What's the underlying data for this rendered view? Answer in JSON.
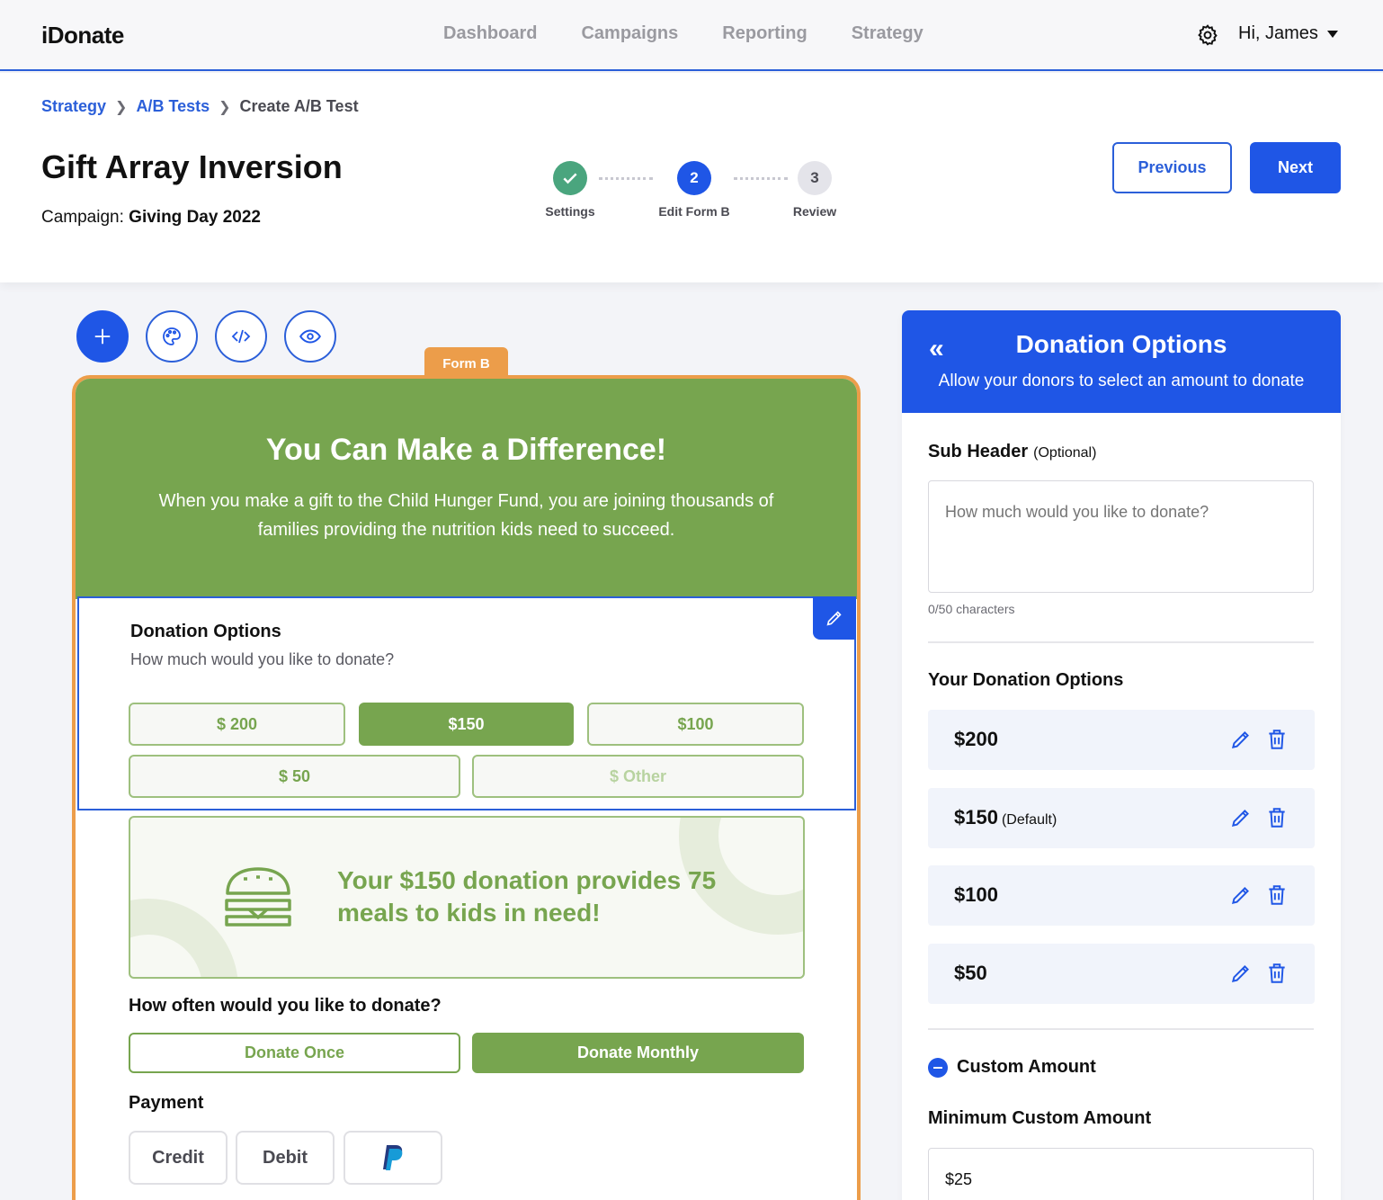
{
  "app": {
    "logo": "iDonate"
  },
  "nav": {
    "items": [
      "Dashboard",
      "Campaigns",
      "Reporting",
      "Strategy"
    ],
    "user_greeting": "Hi, James"
  },
  "breadcrumb": {
    "items": [
      "Strategy",
      "A/B Tests"
    ],
    "current": "Create A/B Test"
  },
  "page": {
    "title": "Gift Array Inversion",
    "campaign_label": "Campaign:",
    "campaign_name": "Giving Day 2022"
  },
  "stepper": {
    "steps": [
      {
        "number": "",
        "label": "Settings",
        "state": "complete"
      },
      {
        "number": "2",
        "label": "Edit Form B",
        "state": "active"
      },
      {
        "number": "3",
        "label": "Review",
        "state": "pending"
      }
    ]
  },
  "actions": {
    "previous": "Previous",
    "next": "Next"
  },
  "toolbar": {
    "icons": [
      "plus-icon",
      "palette-icon",
      "code-icon",
      "eye-icon"
    ]
  },
  "form": {
    "tab_label": "Form B",
    "hero_title": "You Can Make a Difference!",
    "hero_text": "When you make a gift to the Child Hunger Fund, you are joining thousands of families providing the nutrition kids need to succeed.",
    "donation_options_title": "Donation Options",
    "donation_options_sub": "How much would you like to donate?",
    "amounts": [
      "$ 200",
      "$150",
      "$100",
      "$ 50",
      "$ Other"
    ],
    "selected_amount": "$150",
    "impact_message": "Your $150 donation provides 75 meals to kids in need!",
    "frequency_title": "How often would you like to donate?",
    "frequency": {
      "once": "Donate Once",
      "monthly": "Donate Monthly",
      "selected": "Donate Monthly"
    },
    "payment_title": "Payment",
    "payment": [
      "Credit",
      "Debit"
    ]
  },
  "panel": {
    "title": "Donation Options",
    "subtitle": "Allow your donors to select an amount to donate",
    "sub_header_label": "Sub Header",
    "sub_header_optional": "(Optional)",
    "sub_header_value": "How much would you like to donate?",
    "char_count": "0/50 characters",
    "your_options_title": "Your Donation Options",
    "options": [
      {
        "value": "$200",
        "note": ""
      },
      {
        "value": "$150",
        "note": "(Default)"
      },
      {
        "value": "$100",
        "note": ""
      },
      {
        "value": "$50",
        "note": ""
      }
    ],
    "custom_amount_label": "Custom Amount",
    "min_custom_label": "Minimum Custom Amount",
    "min_custom_value": "$25"
  },
  "colors": {
    "brand_blue": "#1f56e6",
    "form_green": "#77a54f",
    "form_orange": "#ec9d4a",
    "success_teal": "#4aa57e"
  }
}
